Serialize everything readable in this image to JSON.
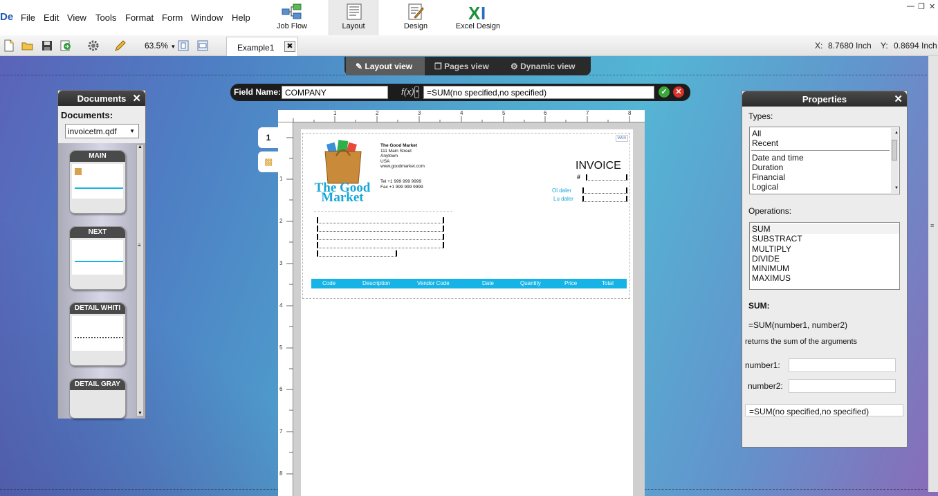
{
  "app": {
    "logo": "De",
    "menu": [
      "File",
      "Edit",
      "View",
      "Tools",
      "Format",
      "Form",
      "Window",
      "Help"
    ],
    "modes": [
      {
        "label": "Job Flow",
        "icon": "job-flow-icon"
      },
      {
        "label": "Layout",
        "icon": "layout-icon",
        "active": true
      },
      {
        "label": "Design",
        "icon": "design-icon"
      },
      {
        "label": "Excel Design",
        "icon": "excel-design-icon"
      }
    ]
  },
  "toolbar": {
    "zoom": "63.5%",
    "doc_tab": "Example1",
    "coord_x_label": "X:",
    "coord_x": "8.7680 Inch",
    "coord_y_label": "Y:",
    "coord_y": "0.8694 Inch"
  },
  "views": [
    "Layout view",
    "Pages view",
    "Dynamic view"
  ],
  "formula_bar": {
    "label": "Field Name:",
    "field_name": "COMPANY",
    "fx": "f(x)",
    "formula": "=SUM(no specified,no specified)"
  },
  "documents_panel": {
    "title": "Documents",
    "label": "Documents:",
    "selected": "invoicetm.qdf",
    "sections": [
      "MAIN",
      "NEXT",
      "DETAIL  WHITI",
      "DETAIL  GRAY"
    ]
  },
  "page_tab": "1",
  "invoice": {
    "company_line1": "The Good",
    "company_line2": "Market",
    "address": [
      "The Good Market",
      "111 Main Street",
      "Anytown",
      "USA",
      "www.goodmarket.com"
    ],
    "phone": "Tel +1  999 999 9999",
    "fax": "Fax +1  999 999 9999",
    "title": "INVOICE",
    "number_label": "#",
    "order_date_label": "Ol daler",
    "due_date_label": "Lu daler",
    "section_badge": "MAIN",
    "columns": [
      "Code",
      "Description",
      "Vendor Code",
      "Date",
      "Quantity",
      "Price",
      "Total"
    ]
  },
  "ruler_h": [
    "1",
    "2",
    "3",
    "4",
    "5",
    "6",
    "7",
    "8"
  ],
  "ruler_v": [
    "1",
    "2",
    "3",
    "4",
    "5",
    "6",
    "7",
    "8"
  ],
  "properties_panel": {
    "title": "Properties",
    "types_label": "Types:",
    "types": [
      "All",
      "Recent",
      "Date and time",
      "Duration",
      "Financial",
      "Logical"
    ],
    "operations_label": "Operations:",
    "operations": [
      "SUM",
      "SUBSTRACT",
      "MULTIPLY",
      "DIVIDE",
      "MINIMUM",
      "MAXIMUS"
    ],
    "func_title": "SUM:",
    "func_signature": "=SUM(number1, number2)",
    "func_desc": "returns the sum of the arguments",
    "arg1_label": "number1:",
    "arg1_value": "",
    "arg2_label": "number2:",
    "arg2_value": "",
    "result": "=SUM(no specified,no specified)"
  }
}
